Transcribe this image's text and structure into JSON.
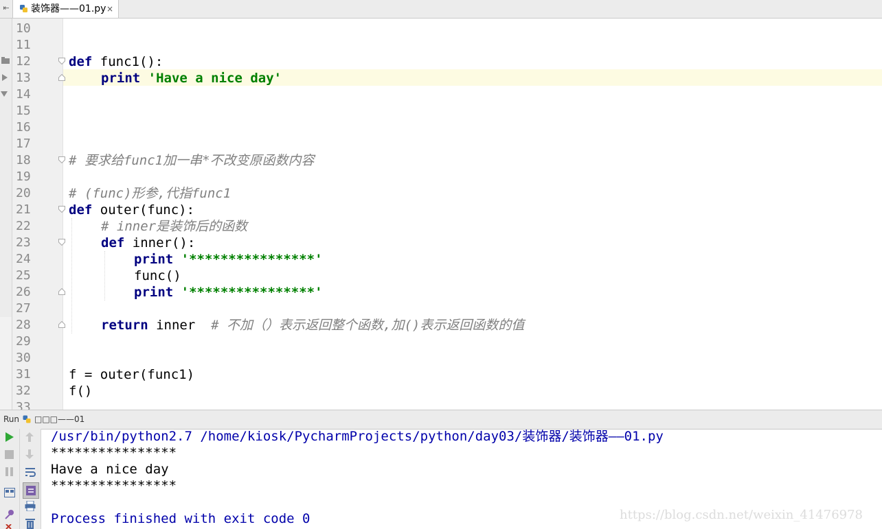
{
  "tab": {
    "filename": "装饰器——01.py",
    "close": "×",
    "back": "⇤"
  },
  "editor": {
    "line_numbers": [
      "10",
      "11",
      "12",
      "13",
      "14",
      "15",
      "16",
      "17",
      "18",
      "19",
      "20",
      "21",
      "22",
      "23",
      "24",
      "25",
      "26",
      "27",
      "28",
      "29",
      "30",
      "31",
      "32",
      "33"
    ],
    "lines": {
      "l12_kw": "def",
      "l12_rest": "func1():",
      "l13_kw": "print",
      "l13_str": "'Have a nice day'",
      "l18_cm": "# 要求给func1加一串*不改变原函数内容",
      "l20_cm": "# (func)形参,代指func1",
      "l21_kw": "def",
      "l21_rest": "outer(func):",
      "l22_cm": "# inner是装饰后的函数",
      "l23_kw": "def",
      "l23_rest": "inner():",
      "l24_kw": "print",
      "l24_str": "'****************'",
      "l25": "func()",
      "l26_kw": "print",
      "l26_str": "'****************'",
      "l28_kw": "return",
      "l28_rest": "inner  ",
      "l28_cm": "# 不加（）表示返回整个函数,加()表示返回函数的值",
      "l31": "f = outer(func1)",
      "l32": "f()"
    }
  },
  "run": {
    "label": "Run",
    "config": "□□□——01",
    "output": {
      "cmd": "/usr/bin/python2.7 /home/kiosk/PycharmProjects/python/day03/装饰器/装饰器——01.py",
      "stars1": "****************",
      "msg": "Have a nice day",
      "stars2": "****************",
      "blank": "",
      "exit": "Process finished with exit code 0"
    }
  },
  "watermark": "https://blog.csdn.net/weixin_41476978",
  "colors": {
    "keyword": "#000080",
    "string": "#008000",
    "comment": "#808080",
    "output_blue": "#0000aa",
    "run_green": "#2fa836"
  }
}
